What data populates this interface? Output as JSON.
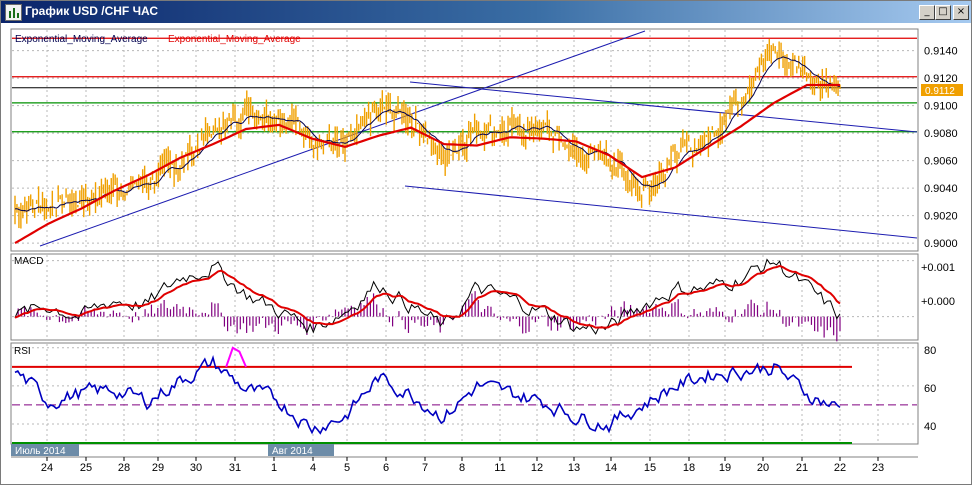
{
  "window": {
    "title": "График USD /CHF ЧАС",
    "minimize_glyph": "_",
    "maximize_glyph": "□",
    "close_glyph": "×",
    "app_icon": "chart-bars-icon"
  },
  "colors": {
    "price": "#f0a000",
    "ema_fast": "#00004f",
    "ema_slow": "#e00000",
    "trend": "#1c1cb0",
    "resistance": "#e00000",
    "support": "#009000",
    "cursor": "#000000",
    "macd_hist": "#800080",
    "rsi": "#0000c0",
    "rsi_overbought": "#ff00ff",
    "current_price_bg": "#f0a000",
    "grid": "#b8b8b8"
  },
  "chart_data": [
    {
      "type": "line",
      "title": "",
      "legend": [
        "Exponential_Moving_Average",
        "Exponential_Moving_Average"
      ],
      "series": [
        {
          "name": "Exponential_Moving_Average",
          "color": "#00004f"
        },
        {
          "name": "Exponential_Moving_Average",
          "color": "#e00000"
        }
      ],
      "ylim": [
        0.8995,
        0.9155
      ],
      "yticks": [
        "0.9140",
        "0.9120",
        "0.9100",
        "0.9080",
        "0.9060",
        "0.9040",
        "0.9020",
        "0.9000"
      ],
      "current_price": "0.9112",
      "horizontal_levels": {
        "resistance": [
          0.9149,
          0.9121
        ],
        "support": [
          0.9102,
          0.9081
        ],
        "cursor": 0.9113
      },
      "price_path": [
        [
          0,
          0.9025
        ],
        [
          1,
          0.9028
        ],
        [
          2,
          0.9032
        ],
        [
          3,
          0.904
        ],
        [
          4,
          0.9044
        ],
        [
          5,
          0.9058
        ],
        [
          6,
          0.9082
        ],
        [
          7,
          0.9096
        ],
        [
          8,
          0.9095
        ],
        [
          9,
          0.9078
        ],
        [
          10,
          0.9068
        ],
        [
          11,
          0.9097
        ],
        [
          12,
          0.9092
        ],
        [
          13,
          0.9062
        ],
        [
          14,
          0.9085
        ],
        [
          15,
          0.9082
        ],
        [
          16,
          0.9085
        ],
        [
          17,
          0.9065
        ],
        [
          18,
          0.9064
        ],
        [
          19,
          0.9038
        ],
        [
          20,
          0.9062
        ],
        [
          21,
          0.9076
        ],
        [
          22,
          0.911
        ],
        [
          23,
          0.914
        ],
        [
          24,
          0.9125
        ],
        [
          25,
          0.911
        ]
      ],
      "ema_slow_path": [
        [
          0,
          0.9
        ],
        [
          1,
          0.9014
        ],
        [
          2,
          0.9025
        ],
        [
          3,
          0.9038
        ],
        [
          4,
          0.9049
        ],
        [
          5,
          0.9062
        ],
        [
          6,
          0.9072
        ],
        [
          7,
          0.9083
        ],
        [
          8,
          0.9086
        ],
        [
          9,
          0.9076
        ],
        [
          10,
          0.907
        ],
        [
          11,
          0.9078
        ],
        [
          12,
          0.9084
        ],
        [
          13,
          0.9072
        ],
        [
          14,
          0.9071
        ],
        [
          15,
          0.9077
        ],
        [
          16,
          0.9076
        ],
        [
          17,
          0.9074
        ],
        [
          18,
          0.9064
        ],
        [
          19,
          0.9048
        ],
        [
          20,
          0.9055
        ],
        [
          21,
          0.907
        ],
        [
          22,
          0.9085
        ],
        [
          23,
          0.9102
        ],
        [
          24,
          0.9115
        ],
        [
          25,
          0.9115
        ]
      ]
    },
    {
      "type": "line",
      "title": "MACD",
      "yticks": [
        "+0.001",
        "+0.000"
      ],
      "ylim": [
        -0.0004,
        0.0011
      ],
      "macd_path": [
        [
          0,
          0.0
        ],
        [
          1,
          0.0002
        ],
        [
          2,
          0.0
        ],
        [
          3,
          0.0003
        ],
        [
          4,
          0.0002
        ],
        [
          5,
          0.0007
        ],
        [
          6,
          0.0009
        ],
        [
          7,
          0.0004
        ],
        [
          8,
          0.0001
        ],
        [
          9,
          -0.0002
        ],
        [
          10,
          0.0001
        ],
        [
          11,
          0.0006
        ],
        [
          12,
          0.0002
        ],
        [
          13,
          -0.0002
        ],
        [
          14,
          0.0005
        ],
        [
          15,
          0.0003
        ],
        [
          16,
          0.0001
        ],
        [
          17,
          -0.0002
        ],
        [
          18,
          -0.0002
        ],
        [
          19,
          0.0002
        ],
        [
          20,
          0.0005
        ],
        [
          21,
          0.0005
        ],
        [
          22,
          0.0007
        ],
        [
          23,
          0.001
        ],
        [
          24,
          0.0005
        ],
        [
          25,
          0.0
        ]
      ]
    },
    {
      "type": "line",
      "title": "RSI",
      "yticks": [
        "80",
        "60",
        "40"
      ],
      "ylim": [
        30,
        82
      ],
      "levels": {
        "upper": 70,
        "middle": 50,
        "lower": 30
      },
      "rsi_path": [
        [
          0,
          68
        ],
        [
          1,
          52
        ],
        [
          2,
          56
        ],
        [
          3,
          58
        ],
        [
          4,
          52
        ],
        [
          5,
          63
        ],
        [
          6,
          72
        ],
        [
          7,
          58
        ],
        [
          8,
          52
        ],
        [
          9,
          38
        ],
        [
          10,
          44
        ],
        [
          11,
          64
        ],
        [
          12,
          56
        ],
        [
          13,
          44
        ],
        [
          14,
          60
        ],
        [
          15,
          56
        ],
        [
          16,
          52
        ],
        [
          17,
          44
        ],
        [
          18,
          40
        ],
        [
          19,
          50
        ],
        [
          20,
          60
        ],
        [
          21,
          66
        ],
        [
          22,
          68
        ],
        [
          23,
          70
        ],
        [
          24,
          56
        ],
        [
          25,
          48
        ]
      ]
    }
  ],
  "x_axis": {
    "labels": [
      "24",
      "25",
      "28",
      "29",
      "30",
      "31",
      "1",
      "4",
      "5",
      "6",
      "7",
      "8",
      "11",
      "12",
      "13",
      "14",
      "15",
      "18",
      "19",
      "20",
      "21",
      "22",
      "23"
    ],
    "period_tags": [
      "Июль 2014",
      "Авг 2014"
    ]
  }
}
